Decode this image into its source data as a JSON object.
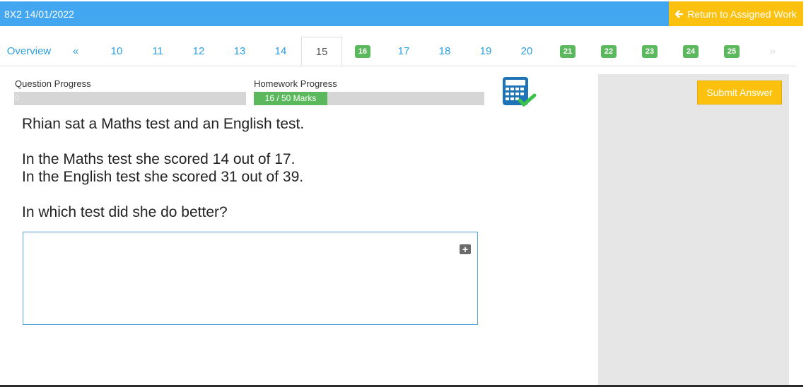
{
  "header": {
    "title": "8X2 14/01/2022",
    "return_label": "Return to Assigned Work",
    "return_icon": "arrow-left-icon"
  },
  "tabs": {
    "overview": "Overview",
    "prev": "«",
    "items": [
      {
        "label": "10",
        "state": "plain"
      },
      {
        "label": "11",
        "state": "plain"
      },
      {
        "label": "12",
        "state": "plain"
      },
      {
        "label": "13",
        "state": "plain"
      },
      {
        "label": "14",
        "state": "plain"
      },
      {
        "label": "15",
        "state": "active"
      },
      {
        "label": "16",
        "state": "completed"
      },
      {
        "label": "17",
        "state": "plain"
      },
      {
        "label": "18",
        "state": "plain"
      },
      {
        "label": "19",
        "state": "plain"
      },
      {
        "label": "20",
        "state": "plain"
      },
      {
        "label": "21",
        "state": "completed"
      },
      {
        "label": "22",
        "state": "completed"
      },
      {
        "label": "23",
        "state": "completed"
      },
      {
        "label": "24",
        "state": "completed"
      },
      {
        "label": "25",
        "state": "completed"
      }
    ],
    "next": "»"
  },
  "progress": {
    "question_label": "Question Progress",
    "question_value": "0",
    "question_fraction": 0,
    "homework_label": "Homework Progress",
    "homework_text": "16 / 50 Marks",
    "homework_fraction": 0.32
  },
  "question": {
    "line1": "Rhian sat a Maths test and an English test.",
    "line2": "In the Maths test she scored 14 out of 17.",
    "line3": "In the English test she scored 31 out of 39.",
    "line4": "In which test did she do better?"
  },
  "answer": {
    "value": "",
    "expand_icon": "plus-square-icon"
  },
  "actions": {
    "submit_label": "Submit Answer"
  },
  "colors": {
    "header_bg": "#42a7f0",
    "accent_yellow": "#fcc10f",
    "completed_green": "#5cb85c",
    "link_blue": "#2e9fe0"
  }
}
